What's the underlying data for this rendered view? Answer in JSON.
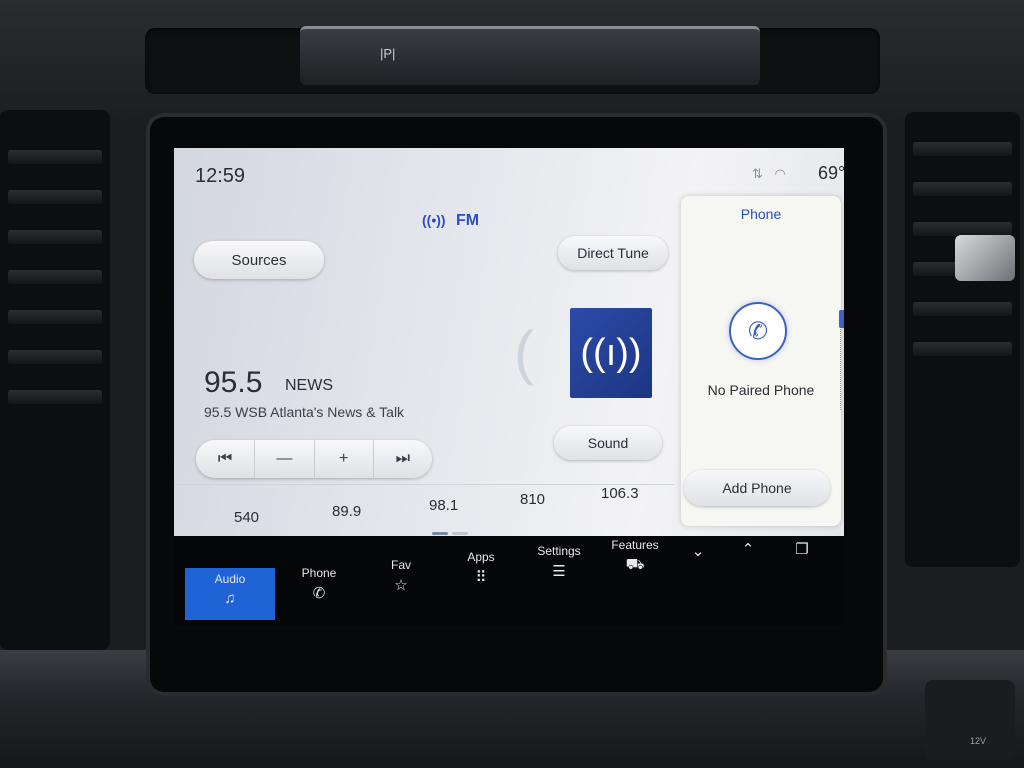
{
  "hardware": {
    "park_label": "|P|",
    "usb_label": "12V"
  },
  "status_bar": {
    "time": "12:59",
    "temperature": "69°",
    "icons": [
      "signal-data-icon",
      "wifi-icon"
    ]
  },
  "source": {
    "band": "FM",
    "sources_label": "Sources",
    "direct_tune_label": "Direct Tune",
    "sound_label": "Sound"
  },
  "station": {
    "frequency": "95.5",
    "genre": "NEWS",
    "name": "95.5 WSB Atlanta's News & Talk"
  },
  "tuner": {
    "seek_back": "⏮",
    "minus": "—",
    "plus": "+",
    "seek_forward": "⏭"
  },
  "presets": [
    "540",
    "89.9",
    "98.1",
    "810",
    "106.3"
  ],
  "phone": {
    "title": "Phone",
    "status": "No Paired Phone",
    "add_label": "Add Phone"
  },
  "nav": {
    "items": [
      {
        "label": "Audio",
        "icon": "music-note-icon"
      },
      {
        "label": "Phone",
        "icon": "phone-icon"
      },
      {
        "label": "Fav",
        "icon": "star-icon"
      },
      {
        "label": "Apps",
        "icon": "grid-icon"
      },
      {
        "label": "Settings",
        "icon": "sliders-icon"
      },
      {
        "label": "Features",
        "icon": "truck-icon"
      }
    ],
    "active": "Audio"
  },
  "colors": {
    "accent": "#2d4fb8",
    "active_nav": "#1f63d6",
    "radio_tile": "#2c4ca8"
  }
}
